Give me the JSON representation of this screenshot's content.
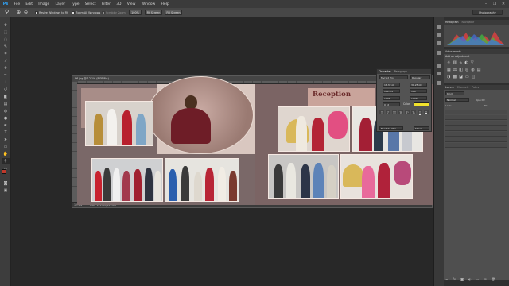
{
  "app": {
    "logo": "Ps"
  },
  "menu": [
    "File",
    "Edit",
    "Image",
    "Layer",
    "Type",
    "Select",
    "Filter",
    "3D",
    "View",
    "Window",
    "Help"
  ],
  "window_controls": {
    "minimize": "–",
    "maximize": "❐",
    "close": "✕"
  },
  "options_bar": {
    "resize_windows_label": "Resize Windows to Fit",
    "zoom_all_label": "Zoom All Windows",
    "scrubby_zoom_label": "Scrubby Zoom",
    "actual_pixels_button": "100%",
    "fit_screen_button": "Fit Screen",
    "fill_screen_button": "Fill Screen",
    "workspace": "Photography"
  },
  "document": {
    "tab_title": "86.jpg @ 12.1% (RGB/8#)",
    "zoom": "12.1%",
    "doc_info": "Doc: 141.8M/141.8M"
  },
  "album": {
    "heading": "Reception"
  },
  "character_panel": {
    "tabs": [
      "Character",
      "Paragraph"
    ],
    "font_family": "Myriad Pro",
    "font_style": "Regular",
    "font_size": "18.32 pt",
    "leading": "30.25 pt",
    "kerning": "Metrics",
    "tracking": "100",
    "vertical_scale": "100%",
    "horizontal_scale": "100%",
    "baseline_shift": "0 pt",
    "color_label": "Color:",
    "color_value": "#f2e22c",
    "type_buttons": [
      "T",
      "T",
      "TT",
      "Tt",
      "T¹",
      "T₁",
      "T",
      "T"
    ],
    "language": "English: USA",
    "antialias": "Sharp"
  },
  "panels": {
    "histogram_tabs": [
      "Histogram",
      "Navigator"
    ],
    "adjustments_tabs": [
      "Adjustments"
    ],
    "adjustments_title": "Add an adjustment",
    "layers_tabs": [
      "Layers",
      "Channels",
      "Paths"
    ],
    "layers_kind": "Kind",
    "layers_blend": "Normal",
    "layers_opacity": "Opacity:",
    "layers_lock": "Lock:",
    "layers_fill": "Fill:"
  },
  "colors": {
    "accent_blue": "#31a8ff",
    "album_bg": "#7b6767",
    "text_color_swatch": "#f2e22c",
    "foreground": "#c0392b",
    "background": "#ffffff"
  },
  "icons": {
    "zoom_tool": "magnifier-icon",
    "move_tool": "move-icon"
  }
}
